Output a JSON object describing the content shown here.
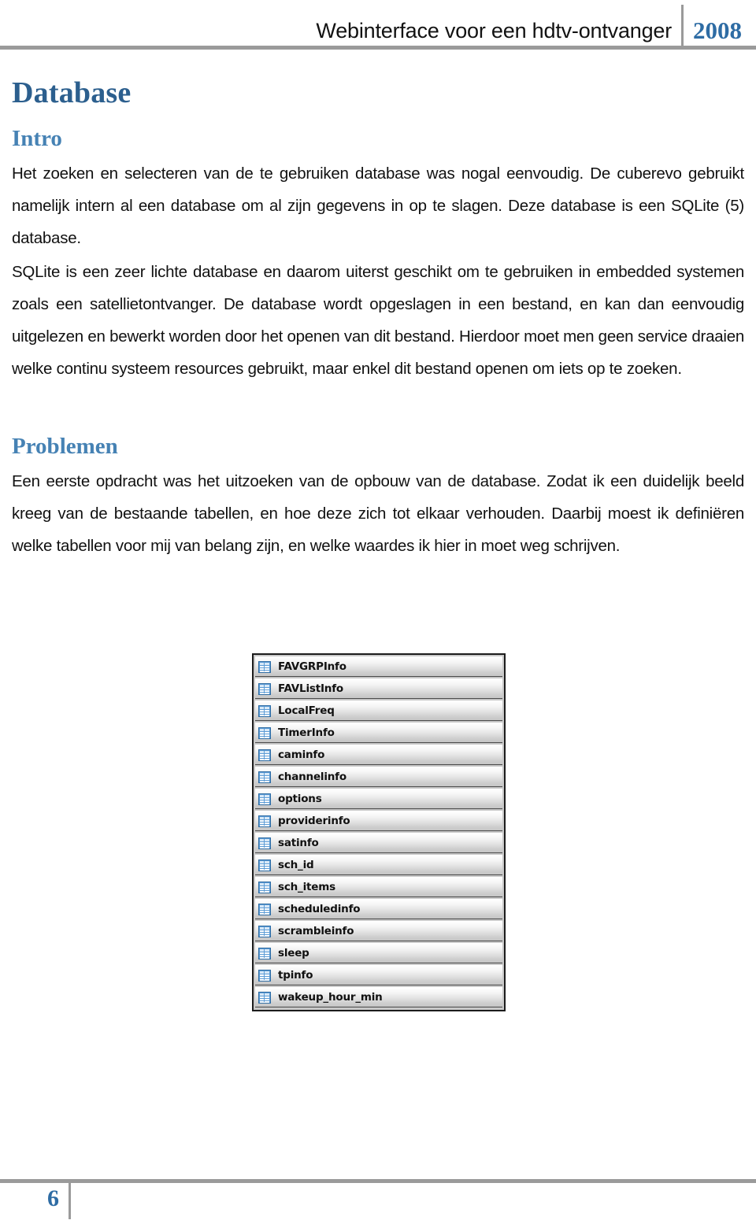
{
  "header": {
    "title": "Webinterface voor een hdtv-ontvanger",
    "year": "2008",
    "divider_color": "#9a9a9a",
    "year_color": "#2e6ca4"
  },
  "document": {
    "title": "Database",
    "title_color": "#2c5f8e",
    "sections": [
      {
        "heading": "Intro",
        "heading_color": "#4682b4",
        "paragraphs": [
          "Het zoeken en selecteren van de te gebruiken database was nogal eenvoudig. De cuberevo gebruikt namelijk intern al een database om al zijn gegevens in op te slagen. Deze database is een SQLite (5) database.",
          "SQLite is een zeer lichte database en daarom uiterst geschikt om te gebruiken in embedded systemen zoals een satellietontvanger. De database wordt opgeslagen in een bestand, en kan dan eenvoudig uitgelezen en bewerkt worden door het openen van dit bestand. Hierdoor moet men geen service draaien welke continu systeem resources gebruikt, maar enkel dit bestand openen om iets op te zoeken."
        ]
      },
      {
        "heading": "Problemen",
        "heading_color": "#4682b4",
        "paragraphs": [
          "Een eerste opdracht was het uitzoeken van de opbouw van de database. Zodat ik een duidelijk beeld kreeg van de bestaande tabellen, en hoe deze zich tot elkaar verhouden. Daarbij moest ik definiëren welke tabellen voor mij van belang zijn, en welke waardes ik hier in moet weg schrijven."
        ]
      }
    ]
  },
  "figure": {
    "name": "database-table-list",
    "icon_name": "table-icon",
    "tables": [
      "FAVGRPInfo",
      "FAVListInfo",
      "LocalFreq",
      "TimerInfo",
      "caminfo",
      "channelinfo",
      "options",
      "providerinfo",
      "satinfo",
      "sch_id",
      "sch_items",
      "scheduledinfo",
      "scrambleinfo",
      "sleep",
      "tpinfo",
      "wakeup_hour_min"
    ]
  },
  "footer": {
    "page_number": "6",
    "page_number_color": "#2e6ca4"
  }
}
